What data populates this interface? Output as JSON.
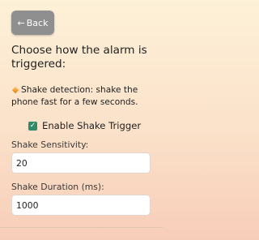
{
  "back_button": {
    "arrow": "←",
    "label": "Back"
  },
  "title": "Choose how the alarm is triggered:",
  "info": {
    "icon": "orange-diamond-icon",
    "text": "Shake detection: shake the phone fast for a few seconds."
  },
  "shake_trigger": {
    "label": "Enable Shake Trigger",
    "checked": true,
    "check_mark": "✓"
  },
  "sensitivity": {
    "label": "Shake Sensitivity:",
    "value": "20"
  },
  "duration": {
    "label": "Shake Duration (ms):",
    "value": "1000"
  },
  "colors": {
    "accent": "#2f8a6a",
    "button": "#8f8f8f"
  }
}
